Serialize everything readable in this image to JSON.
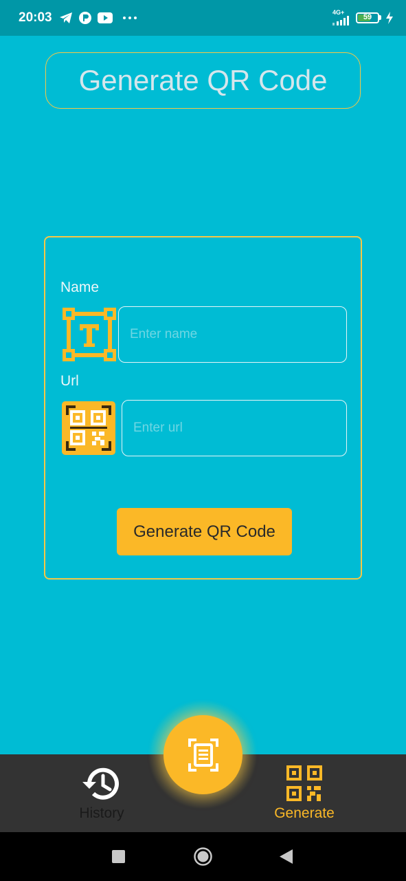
{
  "status_bar": {
    "time": "20:03",
    "network": "4G+",
    "battery": "59",
    "battery_level": 0.59,
    "left_icons": [
      "telegram-icon",
      "app-icon",
      "youtube-icon",
      "more-dots-icon"
    ],
    "right_icons": [
      "signal-icon",
      "battery-icon",
      "charging-icon"
    ]
  },
  "header": {
    "title": "Generate QR Code"
  },
  "form": {
    "name_label": "Name",
    "name_placeholder": "Enter name",
    "name_value": "",
    "name_icon": "text-box-icon",
    "url_label": "Url",
    "url_placeholder": "Enter url",
    "url_value": "",
    "url_icon": "qr-scan-icon",
    "submit_label": "Generate QR Code"
  },
  "bottom_nav": {
    "items": [
      {
        "label": "History",
        "icon": "history-icon",
        "active": false
      },
      {
        "label": "Generate",
        "icon": "qr-code-icon",
        "active": true
      }
    ],
    "fab_icon": "document-scan-icon"
  },
  "colors": {
    "background": "#00bcd4",
    "status_bar": "#0097a7",
    "accent": "#fbb827",
    "border_accent": "#f7c845",
    "nav_background": "#333333",
    "inactive_nav": "#1a1a1a"
  },
  "system_nav": {
    "buttons": [
      "recents-icon",
      "home-icon",
      "back-icon"
    ]
  }
}
